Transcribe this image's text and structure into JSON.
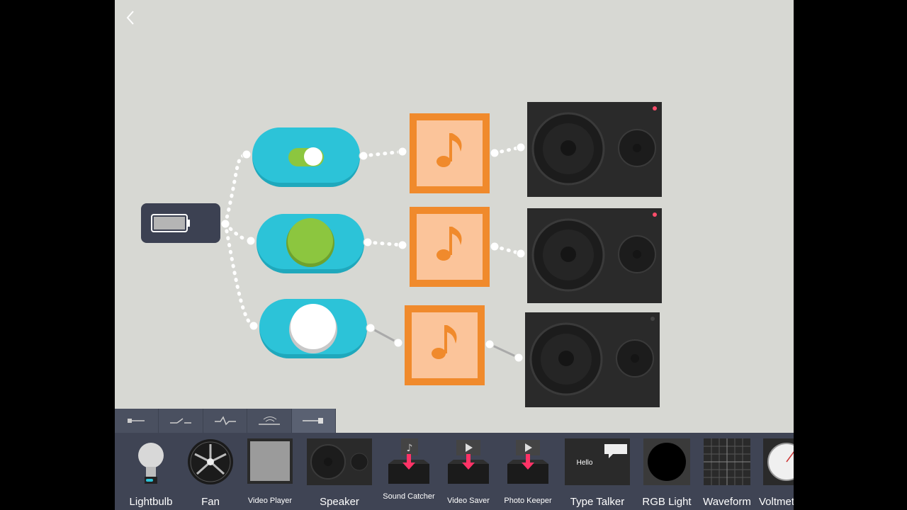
{
  "canvas": {
    "background": "#d7d8d3",
    "battery": {
      "icon": "battery-icon"
    },
    "switches": [
      {
        "kind": "toggle-switch",
        "state": "on"
      },
      {
        "kind": "push-button",
        "state": "pressed"
      },
      {
        "kind": "push-button",
        "state": "released"
      }
    ],
    "sound_blocks": [
      {
        "icon": "music-note-icon"
      },
      {
        "icon": "music-note-icon"
      },
      {
        "icon": "music-note-icon"
      }
    ],
    "speakers": [
      {
        "indicator": "on"
      },
      {
        "indicator": "on"
      },
      {
        "indicator": "off"
      }
    ],
    "colors": {
      "switch": "#29c3d8",
      "green": "#8cc63f",
      "orange": "#f08a2c",
      "speaker": "#2a2a2a"
    }
  },
  "tabs": [
    {
      "icon": "wire-icon"
    },
    {
      "icon": "switch-icon"
    },
    {
      "icon": "signal-icon"
    },
    {
      "icon": "wireless-icon"
    },
    {
      "icon": "output-icon",
      "active": true
    }
  ],
  "palette": {
    "items": [
      {
        "label": "Lightbulb"
      },
      {
        "label": "Fan"
      },
      {
        "label": "Video Player"
      },
      {
        "label": "Speaker"
      },
      {
        "label": "Sound Catcher"
      },
      {
        "label": "Video Saver"
      },
      {
        "label": "Photo Keeper"
      },
      {
        "label": "Type Talker",
        "thumb_text": "Hello"
      },
      {
        "label": "RGB Light"
      },
      {
        "label": "Waveform"
      },
      {
        "label": "Voltmeter"
      }
    ]
  }
}
